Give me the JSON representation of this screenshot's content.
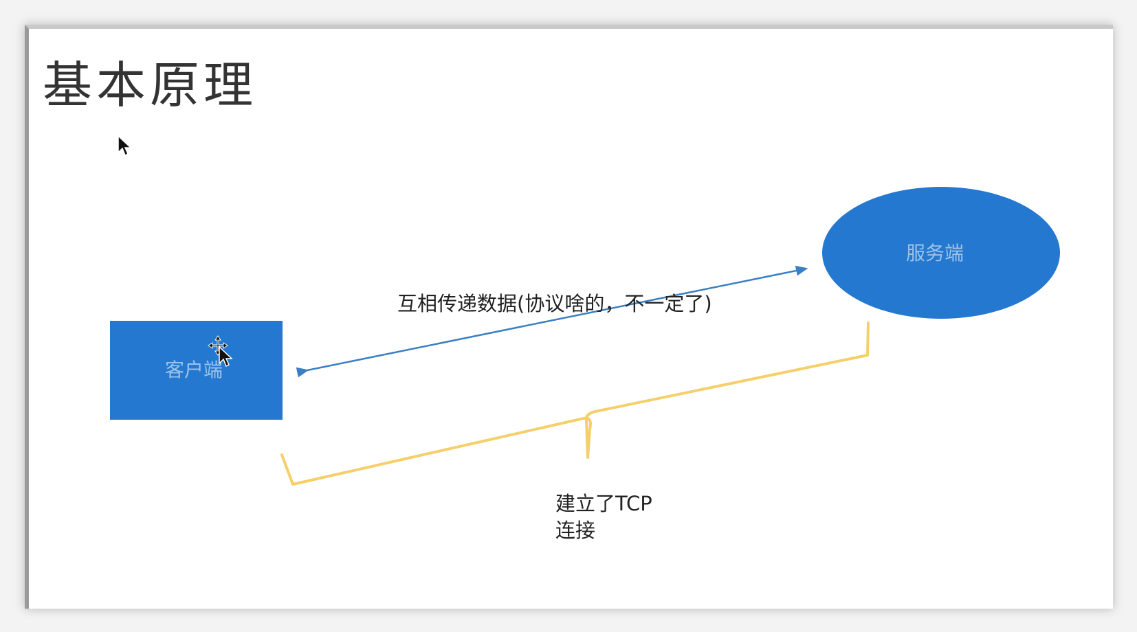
{
  "slide": {
    "title": "基本原理"
  },
  "diagram": {
    "client_label": "客户端",
    "server_label": "服务端",
    "arrow_label": "互相传递数据(协议啥的，不一定了)",
    "brace_label_line1": "建立了TCP",
    "brace_label_line2": "连接"
  },
  "colors": {
    "node_fill": "#2478d0",
    "node_text": "#9cc3ea",
    "arrow": "#3a7fc4",
    "brace": "#f5cf6a"
  },
  "icons": {
    "pointer": "mouse-pointer-icon",
    "move_cursor": "move-cursor-icon"
  }
}
